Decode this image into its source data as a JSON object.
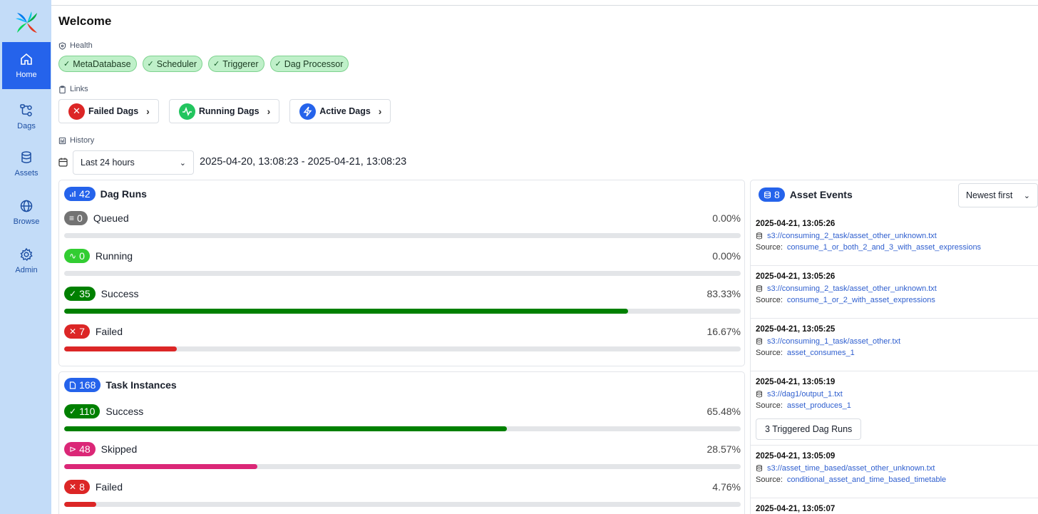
{
  "nav": {
    "items": [
      {
        "label": "Home",
        "icon": "home-icon",
        "active": true
      },
      {
        "label": "Dags",
        "icon": "dags-icon",
        "active": false
      },
      {
        "label": "Assets",
        "icon": "database-icon",
        "active": false
      },
      {
        "label": "Browse",
        "icon": "globe-icon",
        "active": false
      },
      {
        "label": "Admin",
        "icon": "gear-icon",
        "active": false
      }
    ]
  },
  "page": {
    "title": "Welcome"
  },
  "health": {
    "label": "Health",
    "items": [
      "MetaDatabase",
      "Scheduler",
      "Triggerer",
      "Dag Processor"
    ]
  },
  "links": {
    "label": "Links",
    "items": [
      {
        "label": "Failed Dags",
        "color": "#dc2626",
        "icon": "x-icon"
      },
      {
        "label": "Running Dags",
        "color": "#22c55e",
        "icon": "activity-icon"
      },
      {
        "label": "Active Dags",
        "color": "#2563eb",
        "icon": "bolt-icon"
      }
    ]
  },
  "history": {
    "label": "History",
    "range_select": "Last 24 hours",
    "range_text": "2025-04-20, 13:08:23 - 2025-04-21, 13:08:23"
  },
  "dag_runs": {
    "title": "Dag Runs",
    "total": "42",
    "rows": [
      {
        "label": "Queued",
        "count": "0",
        "pct": "0.00%",
        "fraction": 0.0,
        "color": "#737373"
      },
      {
        "label": "Running",
        "count": "0",
        "pct": "0.00%",
        "fraction": 0.0,
        "color": "#32cd32"
      },
      {
        "label": "Success",
        "count": "35",
        "pct": "83.33%",
        "fraction": 0.8333,
        "color": "#008000"
      },
      {
        "label": "Failed",
        "count": "7",
        "pct": "16.67%",
        "fraction": 0.1667,
        "color": "#dc2626"
      }
    ]
  },
  "task_instances": {
    "title": "Task Instances",
    "total": "168",
    "rows": [
      {
        "label": "Success",
        "count": "110",
        "pct": "65.48%",
        "fraction": 0.6548,
        "color": "#008000"
      },
      {
        "label": "Skipped",
        "count": "48",
        "pct": "28.57%",
        "fraction": 0.2857,
        "color": "#db2777"
      },
      {
        "label": "Failed",
        "count": "8",
        "pct": "4.76%",
        "fraction": 0.0476,
        "color": "#dc2626"
      }
    ]
  },
  "asset_events": {
    "title": "Asset Events",
    "count": "8",
    "sort": "Newest first",
    "source_label": "Source:",
    "events": [
      {
        "time": "2025-04-21, 13:05:26",
        "uri": "s3://consuming_2_task/asset_other_unknown.txt",
        "source": "consume_1_or_both_2_and_3_with_asset_expressions"
      },
      {
        "time": "2025-04-21, 13:05:26",
        "uri": "s3://consuming_2_task/asset_other_unknown.txt",
        "source": "consume_1_or_2_with_asset_expressions"
      },
      {
        "time": "2025-04-21, 13:05:25",
        "uri": "s3://consuming_1_task/asset_other.txt",
        "source": "asset_consumes_1"
      },
      {
        "time": "2025-04-21, 13:05:19",
        "uri": "s3://dag1/output_1.txt",
        "source": "asset_produces_1",
        "triggered": "3 Triggered Dag Runs"
      },
      {
        "time": "2025-04-21, 13:05:09",
        "uri": "s3://asset_time_based/asset_other_unknown.txt",
        "source": "conditional_asset_and_time_based_timetable"
      },
      {
        "time": "2025-04-21, 13:05:07"
      }
    ]
  }
}
